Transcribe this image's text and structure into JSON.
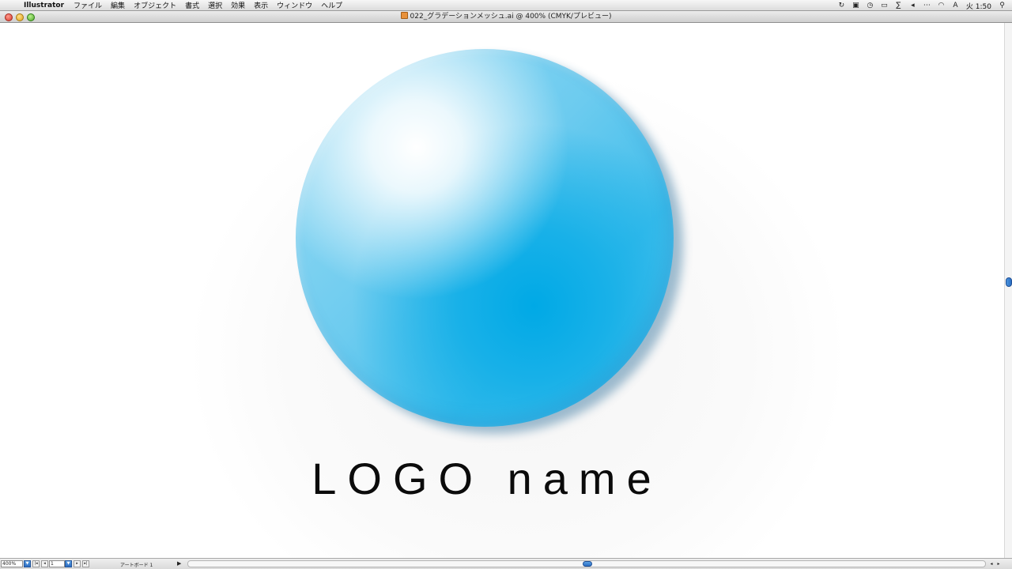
{
  "menubar": {
    "app_name": "Illustrator",
    "items": [
      "ファイル",
      "編集",
      "オブジェクト",
      "書式",
      "選択",
      "効果",
      "表示",
      "ウィンドウ",
      "ヘルプ"
    ],
    "clock": "火 1:50",
    "status_icons": [
      "sync-icon",
      "clipboard-icon",
      "time-machine-icon",
      "display-icon",
      "bluetooth-icon",
      "volume-icon",
      "more-icon",
      "wifi-icon",
      "input-menu-icon",
      "spotlight-icon"
    ]
  },
  "window": {
    "title": "022_グラデーションメッシュ.ai @ 400% (CMYK/プレビュー)"
  },
  "artwork": {
    "logo_text": "LOGO name",
    "colors": {
      "sphere_highlight": "#ffffff",
      "sphere_mid": "#6ccbef",
      "sphere_deep": "#00a9e6",
      "text": "#0b0b0b"
    }
  },
  "statusbar": {
    "zoom": "400%",
    "page": "1",
    "artboard_label": "アートボード 1"
  }
}
